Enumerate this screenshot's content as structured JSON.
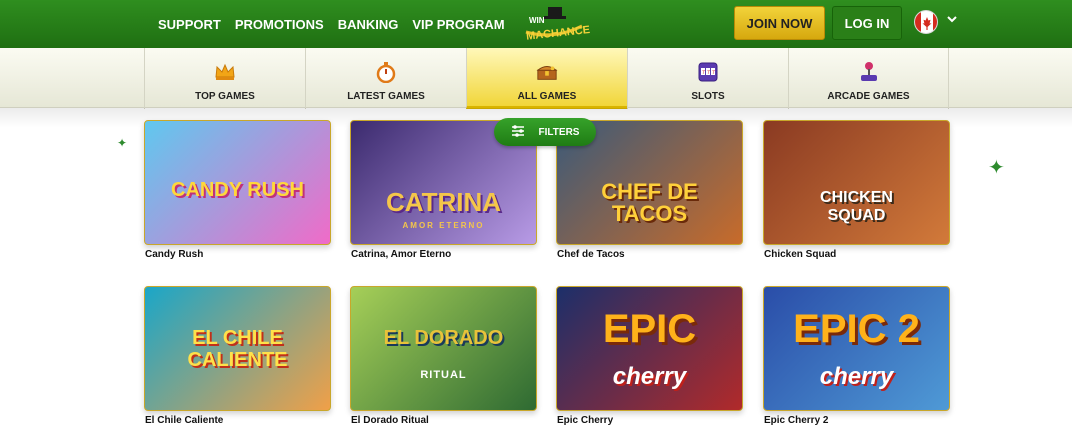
{
  "header": {
    "nav": [
      "SUPPORT",
      "PROMOTIONS",
      "BANKING",
      "VIP PROGRAM"
    ],
    "logo_text_top": "WIN",
    "logo_text_bottom": "MACHANCE",
    "join_label": "JOIN NOW",
    "login_label": "LOG IN"
  },
  "categories": [
    {
      "label": "TOP GAMES",
      "icon": "crown-icon"
    },
    {
      "label": "LATEST GAMES",
      "icon": "stopwatch-icon"
    },
    {
      "label": "ALL GAMES",
      "icon": "treasure-chest-icon",
      "active": true
    },
    {
      "label": "SLOTS",
      "icon": "slot-machine-icon"
    },
    {
      "label": "ARCADE GAMES",
      "icon": "joystick-icon"
    }
  ],
  "filters_label": "FILTERS",
  "games": [
    {
      "title": "Candy Rush",
      "art": "CANDY RUSH",
      "colors": [
        "#5fc8ef",
        "#f06bc8"
      ]
    },
    {
      "title": "Catrina, Amor Eterno",
      "art": "CATRINA",
      "sub": "AMOR ETERNO",
      "colors": [
        "#3b2a6e",
        "#b89be6"
      ]
    },
    {
      "title": "Chef de Tacos",
      "art": "CHEF DE TACOS",
      "colors": [
        "#3a5a7a",
        "#c86b2a"
      ]
    },
    {
      "title": "Chicken Squad",
      "art": "CHICKEN SQUAD",
      "colors": [
        "#8a3a22",
        "#d27a3a"
      ]
    },
    {
      "title": "El Chile Caliente",
      "art": "EL CHILE CALIENTE",
      "colors": [
        "#1aa6c8",
        "#f0a048"
      ]
    },
    {
      "title": "El Dorado Ritual",
      "art": "EL DORADO",
      "sub": "RITUAL",
      "colors": [
        "#a6cf58",
        "#2e6a32"
      ]
    },
    {
      "title": "Epic Cherry",
      "art": "EPIC",
      "sub": "cherry",
      "colors": [
        "#1c2f6a",
        "#b12a2a"
      ]
    },
    {
      "title": "Epic Cherry 2",
      "art": "EPIC 2",
      "sub": "cherry",
      "colors": [
        "#2a4da8",
        "#4f9ad6"
      ]
    }
  ]
}
